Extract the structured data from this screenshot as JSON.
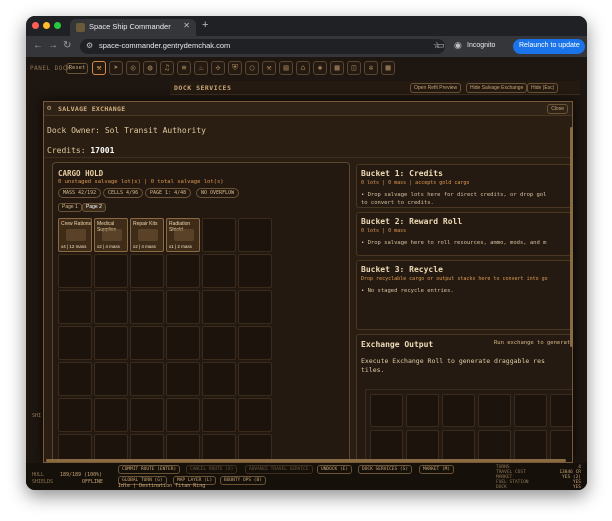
{
  "browser": {
    "tab_title": "Space Ship Commander",
    "url": "space-commander.gentrydemchak.com",
    "incognito_label": "Incognito",
    "relaunch_label": "Relaunch to update"
  },
  "panel_dock": {
    "label": "PANEL DOCK",
    "reset_label": "Reset"
  },
  "dock_services": {
    "title": "DOCK SERVICES",
    "buttons": [
      "Open Refit Preview",
      "Hide Salvage Exchange",
      "Hide (Esc)"
    ]
  },
  "salvage_exchange": {
    "title": "SALVAGE EXCHANGE",
    "close_label": "Close",
    "dock_owner_label": "Dock Owner:",
    "dock_owner": "Sol Transit Authority",
    "credits_label": "Credits:",
    "credits_value": "17001"
  },
  "cargo_hold": {
    "title": "CARGO HOLD",
    "subtitle": "0 unstaged salvage lot(s) | 0 total salvage lot(s)",
    "chips": [
      "MASS 42/192",
      "CELLS 4/96",
      "PAGE 1: 4/48",
      "NO OVERFLOW"
    ],
    "pages": [
      "Page 1",
      "Page 2"
    ],
    "items": [
      {
        "name": "Crew Rations",
        "footer": "x4 | 12 mass"
      },
      {
        "name": "Medical Supplies",
        "footer": "x2 | 4 mass"
      },
      {
        "name": "Repair Kits",
        "footer": "x2 | 4 mass"
      },
      {
        "name": "Radiation Shield",
        "footer": "x1 | 2 mass"
      }
    ]
  },
  "buckets": [
    {
      "title": "Bucket 1: Credits",
      "subtitle": "0 lots | 0 mass | accepts gold cargo",
      "body_lines": [
        "• Drop salvage lots here for direct credits, or drop gol",
        "  to convert to credits."
      ]
    },
    {
      "title": "Bucket 2: Reward Roll",
      "subtitle": "0 lots | 0 mass",
      "body_lines": [
        "• Drop salvage here to roll resources, ammo, mods, and m"
      ]
    },
    {
      "title": "Bucket 3: Recycle",
      "subtitle": "Drop recyclable cargo or output stacks here to convert into go",
      "body_lines": [
        "• No staged recycle entries."
      ]
    }
  ],
  "exchange_output": {
    "title": "Exchange Output",
    "run_label": "Run exchange to generat",
    "body_lines": [
      "Execute Exchange Roll to generate draggable res",
      "tiles."
    ]
  },
  "bottom_bar": {
    "commands_row1": [
      "COMMIT ROUTE (ENTER)",
      "CANCEL ROUTE (X)",
      "ADVANCE TRAVEL SERVICE",
      "UNDOCK (E)",
      "DOCK SERVICES (S)",
      "MARKET (M)"
    ],
    "commands_row2": [
      "GLOBAL TURN (G)",
      "MAP LAYER (L)",
      "BOUNTY OPS (B)"
    ],
    "hull_label": "HULL",
    "hull_value": "189/189 (100%)",
    "shields_label": "SHIELDS",
    "shields_value": "OFFLINE",
    "status_text": "Idle | Destination Titan Ring",
    "side_label": "SHI",
    "stats": [
      {
        "label": "TURNS",
        "value": "4"
      },
      {
        "label": "TRAVEL COST",
        "value": "13846 CR"
      },
      {
        "label": "MARKET",
        "value": "YES (2)"
      },
      {
        "label": "FUEL STATION",
        "value": "YES"
      },
      {
        "label": "DOCK",
        "value": "YES"
      }
    ]
  },
  "colors": {
    "accent": "#e09a4f",
    "panel_bg": "#2a1e13",
    "border": "#7a5a36"
  }
}
